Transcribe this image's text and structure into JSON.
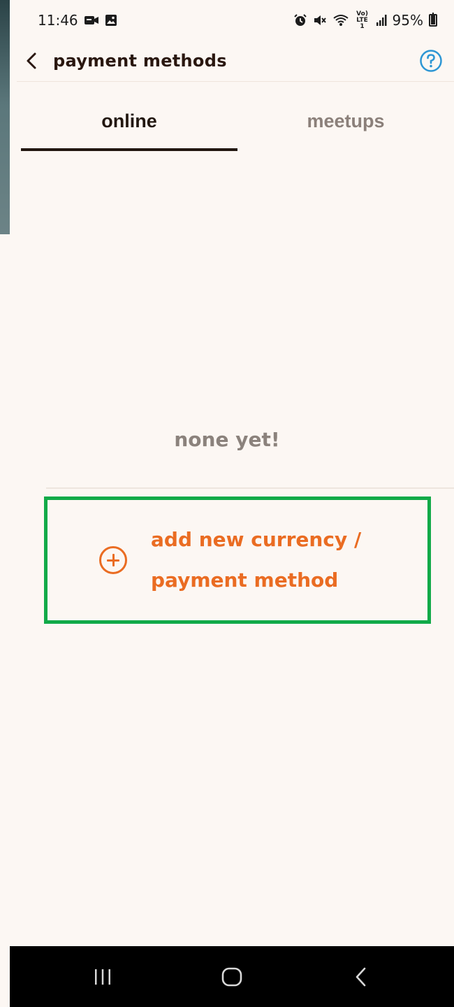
{
  "status_bar": {
    "time": "11:46",
    "battery_percent": "95%",
    "left_icons": [
      "video-call-icon",
      "image-icon"
    ],
    "right_icons": [
      "alarm-icon",
      "mute-icon",
      "wifi-icon",
      "volte-lte-icon",
      "signal-icon",
      "battery-icon"
    ],
    "network_label": "Vo) LTE1"
  },
  "header": {
    "title": "payment methods",
    "back_icon": "chevron-left-icon",
    "help_icon": "help-circle-icon"
  },
  "tabs": [
    {
      "label": "online",
      "active": true
    },
    {
      "label": "meetups",
      "active": false
    }
  ],
  "empty_state": {
    "text": "none yet!"
  },
  "add_button": {
    "line1": "add new currency /",
    "line2": "payment method",
    "icon": "plus-circle-icon"
  },
  "nav_bar": {
    "buttons": [
      "recent-apps-icon",
      "home-icon",
      "back-icon"
    ]
  },
  "colors": {
    "background": "#fcf7f3",
    "accent_orange": "#ea6c22",
    "highlight_green": "#11aa48",
    "help_blue": "#2d96d4",
    "text_dark": "#221710",
    "text_muted": "#8b807a"
  }
}
